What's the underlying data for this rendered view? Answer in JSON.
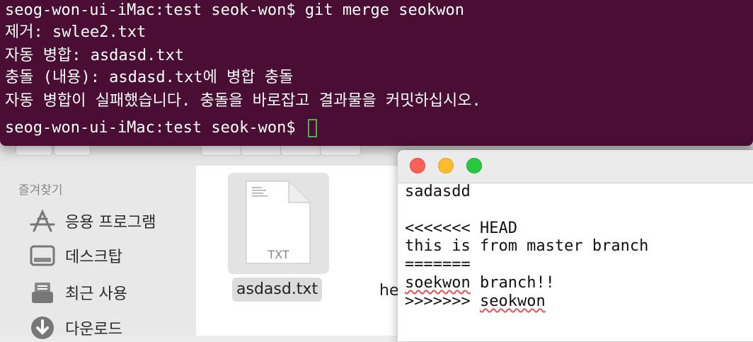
{
  "terminal": {
    "lines": [
      "seog-won-ui-iMac:test seok-won$ git merge seokwon",
      "제거: swlee2.txt",
      "자동 병합: asdasd.txt",
      "충돌 (내용): asdasd.txt에 병합 충돌",
      "자동 병합이 실패했습니다. 충돌을 바로잡고 결과물을 커밋하십시오.",
      "seog-won-ui-iMac:test seok-won$ "
    ],
    "background": "#4a0e34",
    "cursor_color": "#4caf50"
  },
  "finder": {
    "sidebar": {
      "heading": "즐겨찾기",
      "items": [
        {
          "label": "응용 프로그램",
          "icon": "applications-icon"
        },
        {
          "label": "데스크탑",
          "icon": "desktop-icon"
        },
        {
          "label": "최근 사용",
          "icon": "recents-icon"
        },
        {
          "label": "다운로드",
          "icon": "downloads-icon"
        }
      ]
    },
    "files": [
      {
        "name": "asdasd.txt",
        "type_label": "TXT",
        "selected": true
      },
      {
        "name": "he"
      }
    ]
  },
  "editor": {
    "lines": [
      "sadasdd",
      "",
      "<<<<<<< HEAD",
      "this is from master branch",
      "=======",
      "soekwon branch!!",
      ">>>>>>> seokwon"
    ],
    "misspelled": [
      "soekwon",
      "seokwon"
    ],
    "traffic_lights": {
      "close": "#fe5f57",
      "minimize": "#febc2e",
      "zoom": "#28c840"
    }
  }
}
